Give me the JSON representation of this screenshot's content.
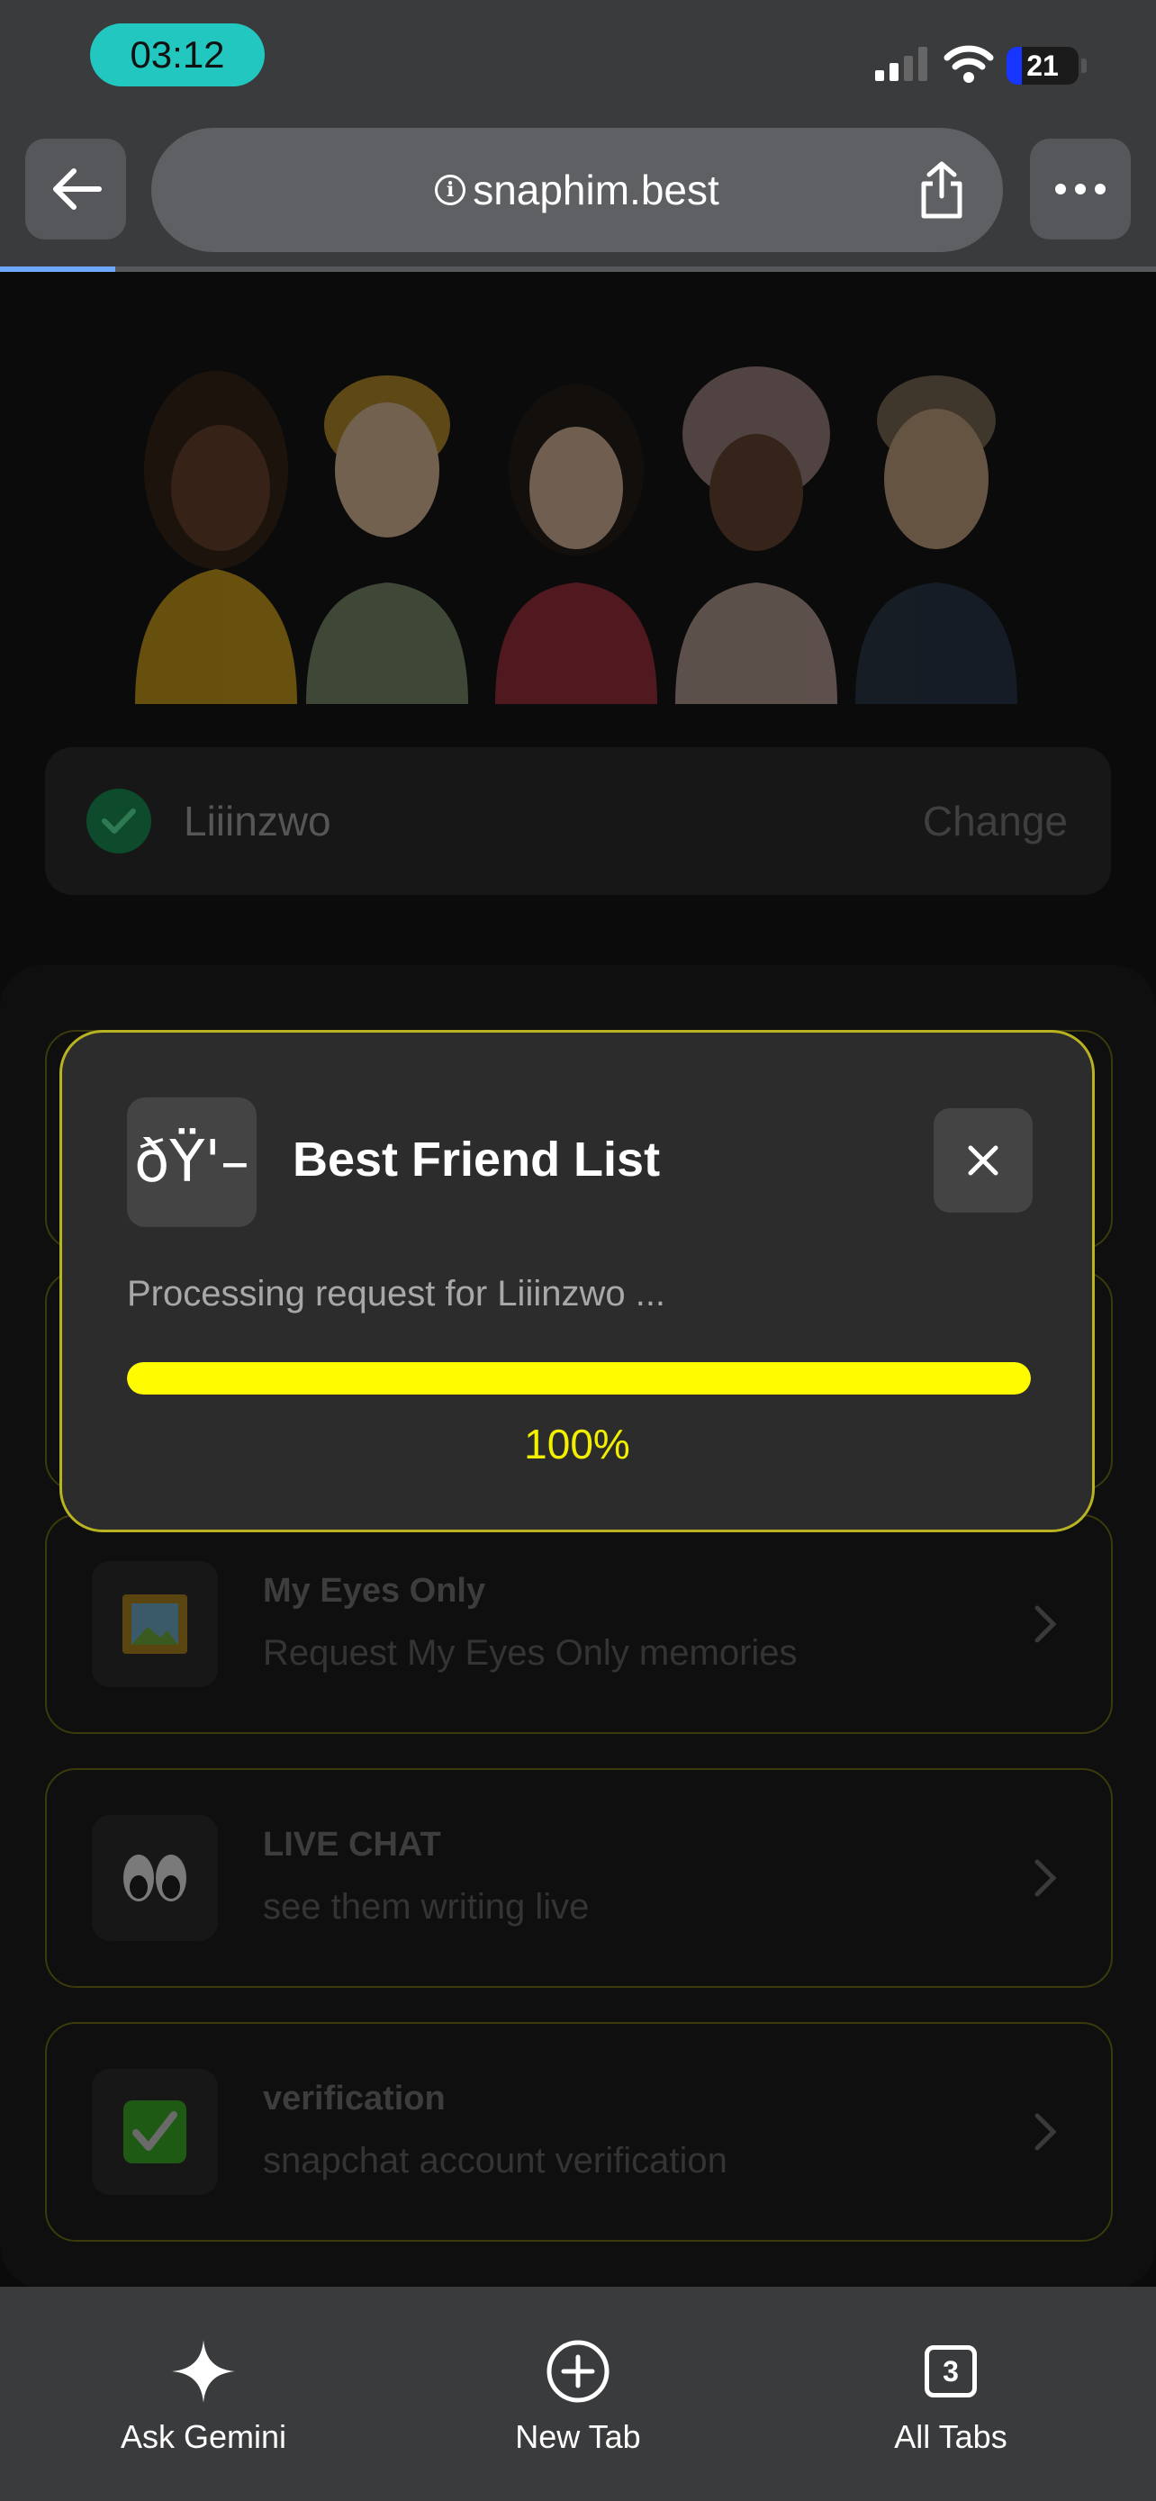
{
  "status_bar": {
    "time": "03:12",
    "battery": "21",
    "battery_level": 0.21
  },
  "browser": {
    "url": "snaphim.best",
    "load_progress": 0.1
  },
  "user": {
    "name": "Liiinzwo",
    "change_label": "Change"
  },
  "options": [
    {
      "title": "My Eyes Only",
      "subtitle": "Request My Eyes Only memories",
      "icon": "picture-frame-icon"
    },
    {
      "title": "LIVE CHAT",
      "subtitle": "see them writing live",
      "icon": "eyes-icon"
    },
    {
      "title": "verification",
      "subtitle": "snapchat account verification",
      "icon": "check-box-icon"
    }
  ],
  "modal": {
    "icon_text": "ðŸ'–",
    "title": "Best Friend List",
    "status": "Processing request for Liiinzwo ...",
    "percent_label": "100%",
    "progress": 1.0
  },
  "toolbar": {
    "ask_label": "Ask Gemini",
    "new_tab_label": "New Tab",
    "all_tabs_label": "All Tabs",
    "tab_count": "3"
  },
  "colors": {
    "accent": "#fffc00",
    "status_pill": "#22c7bf",
    "success": "#0e4a2c"
  }
}
